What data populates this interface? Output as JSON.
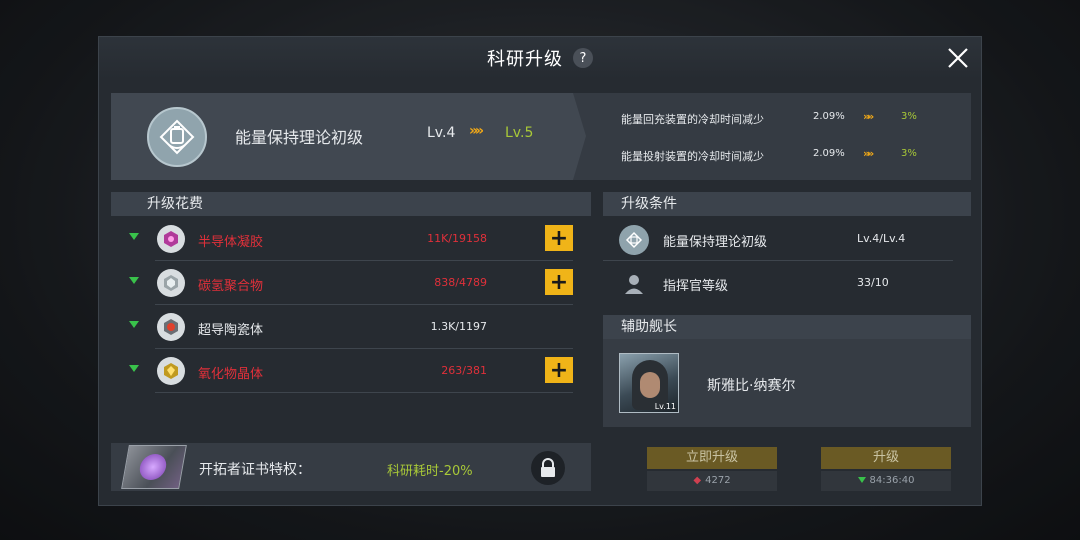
{
  "dialog": {
    "title": "科研升级",
    "help": "?"
  },
  "tech": {
    "name": "能量保持理论初级",
    "level_from": "Lv.4",
    "level_to": "Lv.5",
    "arrow": "»»",
    "effects": [
      {
        "name": "能量回充装置的冷却时间减少",
        "current": "2.09%",
        "next": "3%"
      },
      {
        "name": "能量投射装置的冷却时间减少",
        "current": "2.09%",
        "next": "3%"
      }
    ]
  },
  "cost": {
    "header": "升级花费",
    "items": [
      {
        "name": "半导体凝胶",
        "amount": "11K/19158",
        "insufficient": true,
        "icon": "gel-icon"
      },
      {
        "name": "碳氢聚合物",
        "amount": "838/4789",
        "insufficient": true,
        "icon": "polymer-icon"
      },
      {
        "name": "超导陶瓷体",
        "amount": "1.3K/1197",
        "insufficient": false,
        "icon": "ceramic-icon"
      },
      {
        "name": "氧化物晶体",
        "amount": "263/381",
        "insufficient": true,
        "icon": "crystal-icon"
      }
    ],
    "plus": "+"
  },
  "pioneer": {
    "label": "开拓者证书特权：",
    "bonus": "科研耗时-20%"
  },
  "conditions": {
    "header": "升级条件",
    "items": [
      {
        "name": "能量保持理论初级",
        "value": "Lv.4/Lv.4"
      },
      {
        "name": "指挥官等级",
        "value": "33/10"
      }
    ]
  },
  "captain": {
    "header": "辅助舰长",
    "name": "斯雅比·纳赛尔",
    "level_tag": "Lv.11"
  },
  "actions": {
    "instant_label": "立即升级",
    "instant_cost": "4272",
    "upgrade_label": "升级",
    "time": "84:36:40"
  },
  "colors": {
    "accent": "#f0b418",
    "insufficient": "#e0303a",
    "bonus": "#a8c838"
  }
}
